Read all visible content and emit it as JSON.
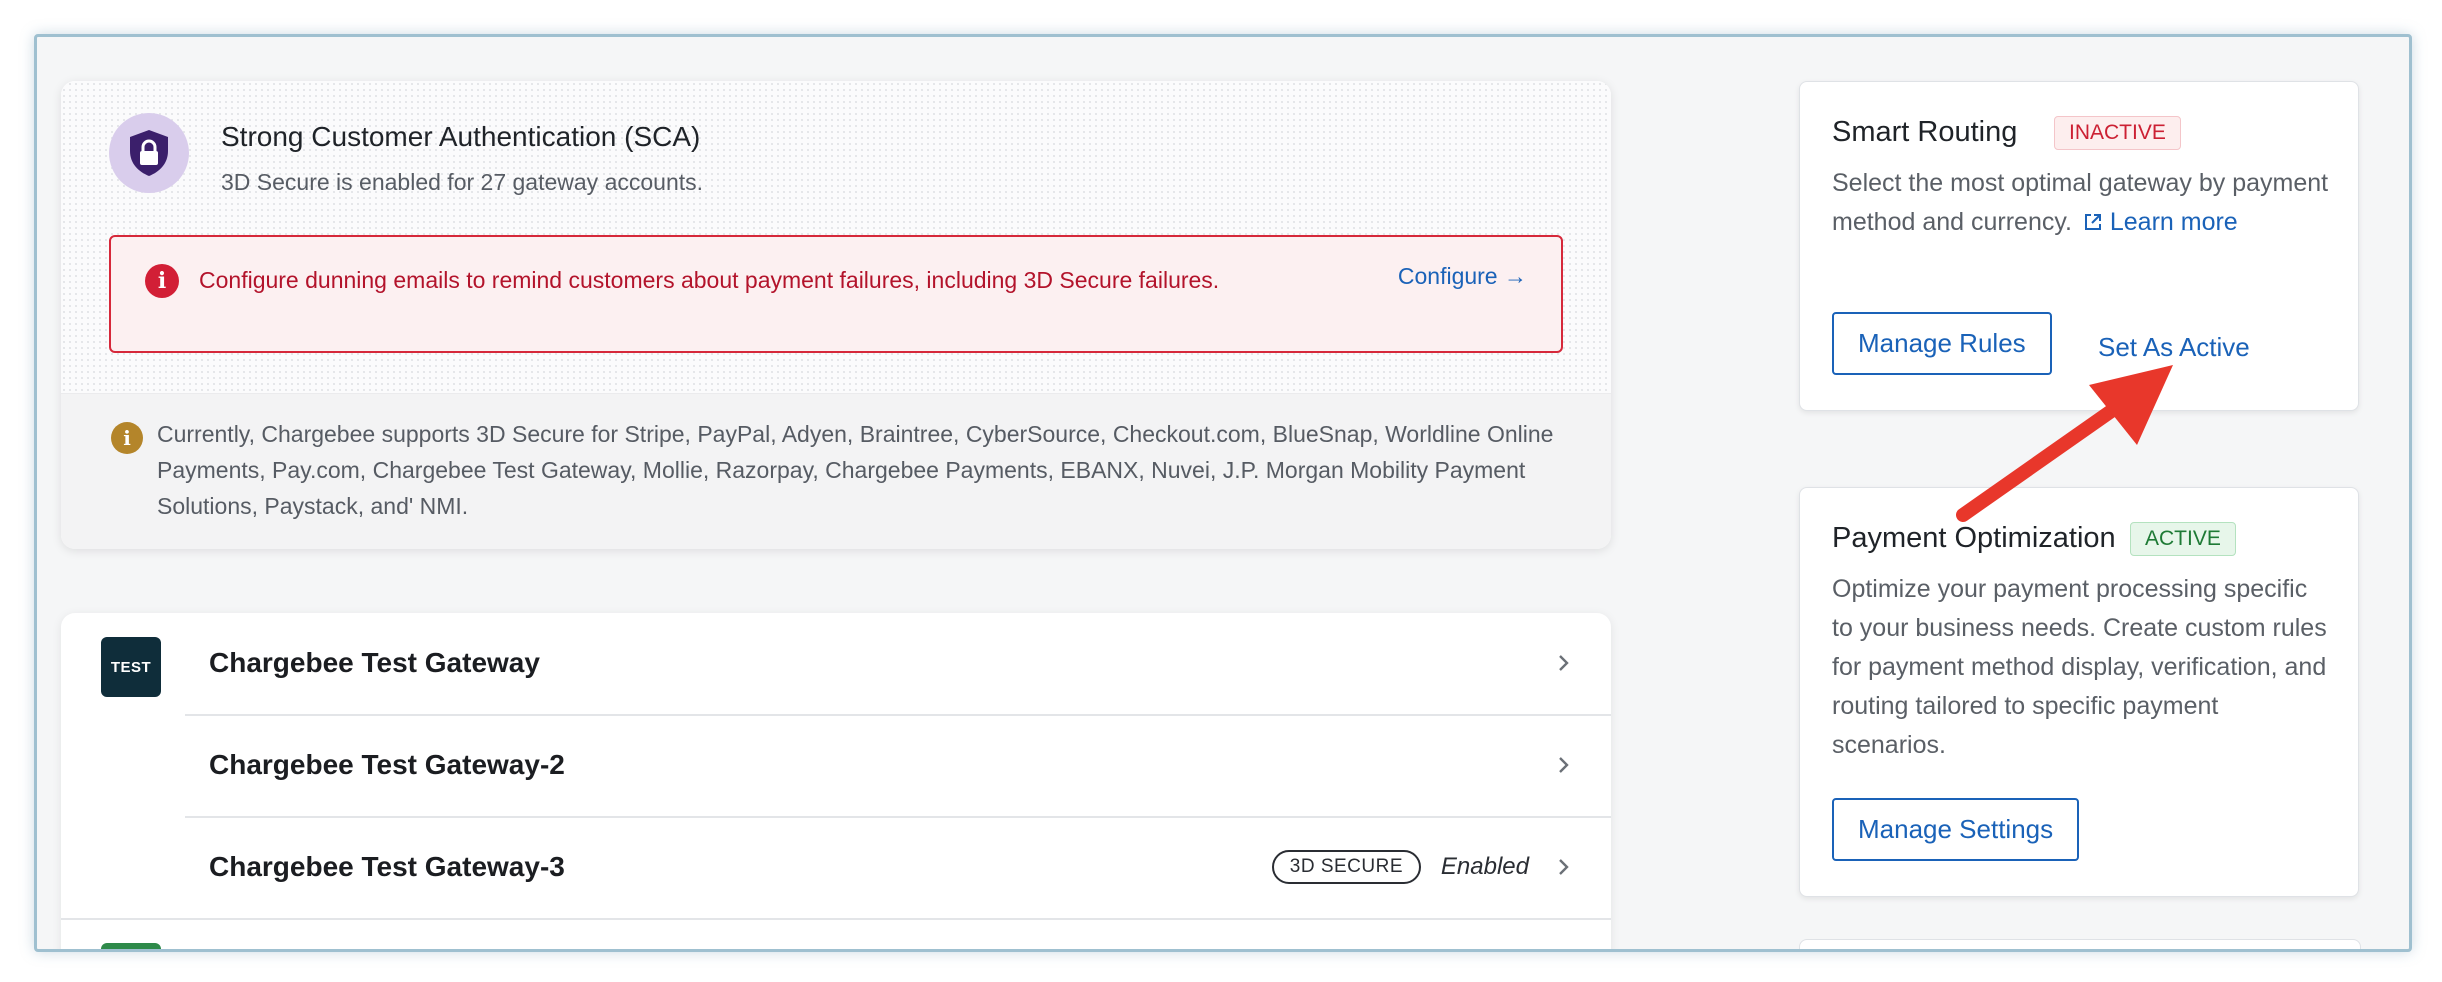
{
  "sca": {
    "title": "Strong Customer Authentication (SCA)",
    "subtitle": "3D Secure is enabled for 27 gateway accounts.",
    "alert_text": "Configure dunning emails to remind customers about payment failures, including 3D Secure failures.",
    "alert_link": "Configure →",
    "info_text": "Currently, Chargebee supports 3D Secure for Stripe, PayPal, Adyen, Braintree, CyberSource, Checkout.com, BlueSnap, Worldline Online Payments, Pay.com, Chargebee Test Gateway, Mollie, Razorpay, Chargebee Payments, EBANX, Nuvei, J.P. Morgan Mobility Payment Solutions, Paystack, and' NMI."
  },
  "gateways": {
    "logo_text": "TEST",
    "items": [
      {
        "name": "Chargebee Test Gateway"
      },
      {
        "name": "Chargebee Test Gateway-2"
      },
      {
        "name": "Chargebee Test Gateway-3",
        "badge": "3D SECURE",
        "status": "Enabled"
      }
    ]
  },
  "smart_routing": {
    "title": "Smart Routing",
    "status": "INACTIVE",
    "description": "Select the most optimal gateway by payment method and currency.",
    "learn_more": "Learn more",
    "manage_rules": "Manage Rules",
    "set_active": "Set As Active"
  },
  "payment_optimization": {
    "title": "Payment Optimization",
    "status": "ACTIVE",
    "description": "Optimize your payment processing specific to your business needs. Create custom rules for payment method display, verification, and routing tailored to specific payment scenarios.",
    "manage_settings": "Manage Settings"
  },
  "colors": {
    "accent": "#1a62b8",
    "alert_red": "#d6283a",
    "active_green": "#1e7a35",
    "annotation_arrow": "#e8372b"
  },
  "icons": [
    "shield-lock-icon",
    "alert-icon",
    "info-icon",
    "chevron-right-icon",
    "external-link-icon",
    "annotation-arrow"
  ]
}
